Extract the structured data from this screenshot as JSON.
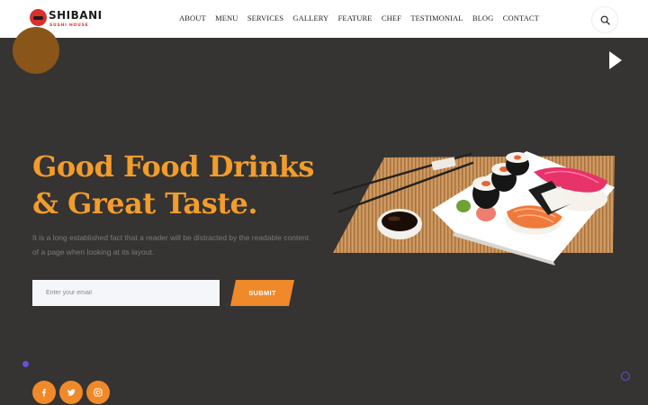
{
  "brand": {
    "name": "SHIBANI",
    "tagline": "SUSHI HOUSE"
  },
  "nav": {
    "items": [
      {
        "label": "ABOUT"
      },
      {
        "label": "MENU"
      },
      {
        "label": "SERVICES"
      },
      {
        "label": "GALLERY"
      },
      {
        "label": "FEATURE"
      },
      {
        "label": "CHEF"
      },
      {
        "label": "TESTIMONIAL"
      },
      {
        "label": "BLOG"
      },
      {
        "label": "CONTACT"
      }
    ]
  },
  "hero": {
    "title_line1": "Good Food Drinks",
    "title_line2": "& Great Taste.",
    "description": "It is a long established fact that a reader will be distracted by the readable content of a page when looking at its layout.",
    "email_placeholder": "Enter your email",
    "submit_label": "SUBMIT"
  },
  "social": [
    {
      "icon": "facebook-icon"
    },
    {
      "icon": "twitter-icon"
    },
    {
      "icon": "instagram-icon"
    }
  ],
  "colors": {
    "accent": "#f0892a",
    "title": "#f39c2c",
    "background": "#353432",
    "header": "#ffffff",
    "decorative_purple": "#6b4fd6"
  }
}
